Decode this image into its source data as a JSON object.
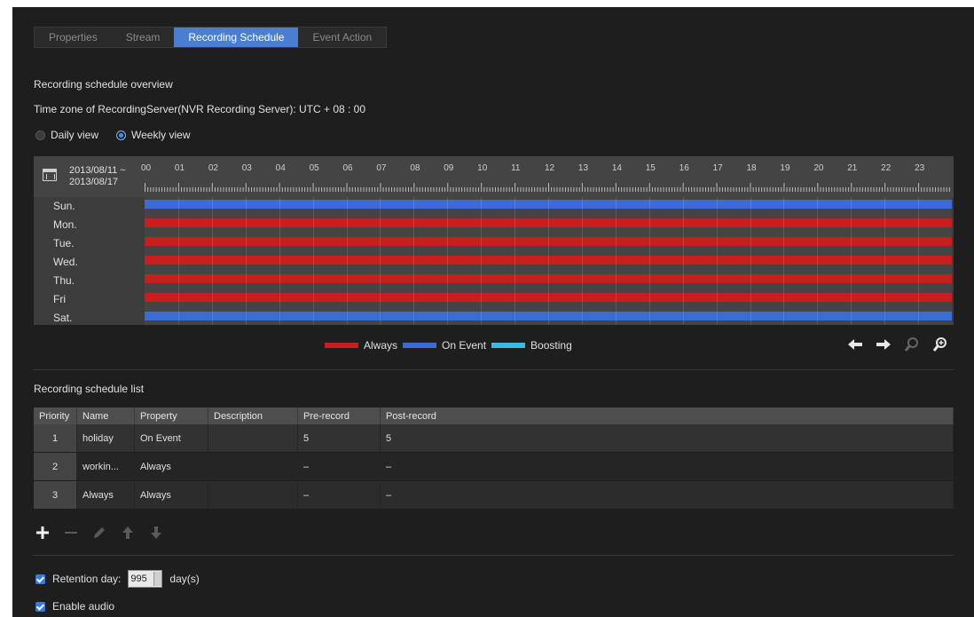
{
  "tabs": [
    {
      "label": "Properties",
      "active": false
    },
    {
      "label": "Stream",
      "active": false
    },
    {
      "label": "Recording Schedule",
      "active": true
    },
    {
      "label": "Event Action",
      "active": false
    }
  ],
  "overview": {
    "title": "Recording schedule overview",
    "timezone": "Time zone of RecordingServer(NVR Recording Server): UTC + 08 : 00",
    "views": [
      {
        "label": "Daily view",
        "selected": false
      },
      {
        "label": "Weekly view",
        "selected": true
      }
    ]
  },
  "schedule": {
    "date_range_start": "2013/08/11 ~",
    "date_range_end": "2013/08/17",
    "hours": [
      "00",
      "01",
      "02",
      "03",
      "04",
      "05",
      "06",
      "07",
      "08",
      "09",
      "10",
      "11",
      "12",
      "13",
      "14",
      "15",
      "16",
      "17",
      "18",
      "19",
      "20",
      "21",
      "22",
      "23"
    ],
    "days": [
      {
        "label": "Sun.",
        "type": "event"
      },
      {
        "label": "Mon.",
        "type": "always"
      },
      {
        "label": "Tue.",
        "type": "always"
      },
      {
        "label": "Wed.",
        "type": "always"
      },
      {
        "label": "Thu.",
        "type": "always"
      },
      {
        "label": "Fri",
        "type": "always"
      },
      {
        "label": "Sat.",
        "type": "event"
      }
    ]
  },
  "legend": {
    "always": "Always",
    "on_event": "On Event",
    "boosting": "Boosting",
    "colors": {
      "always": "#c81e1e",
      "on_event": "#3b6cd4",
      "boosting": "#3fb8e8"
    }
  },
  "list": {
    "title": "Recording schedule list",
    "columns": [
      "Priority",
      "Name",
      "Property",
      "Description",
      "Pre-record",
      "Post-record"
    ],
    "rows": [
      {
        "priority": "1",
        "name": "holiday",
        "property": "On Event",
        "description": "",
        "pre": "5",
        "post": "5"
      },
      {
        "priority": "2",
        "name": "workin...",
        "property": "Always",
        "description": "",
        "pre": "–",
        "post": "–"
      },
      {
        "priority": "3",
        "name": "Always",
        "property": "Always",
        "description": "",
        "pre": "–",
        "post": "–"
      }
    ]
  },
  "retention": {
    "label": "Retention day:",
    "value": "995",
    "unit": "day(s)"
  },
  "audio": {
    "label": "Enable audio"
  }
}
